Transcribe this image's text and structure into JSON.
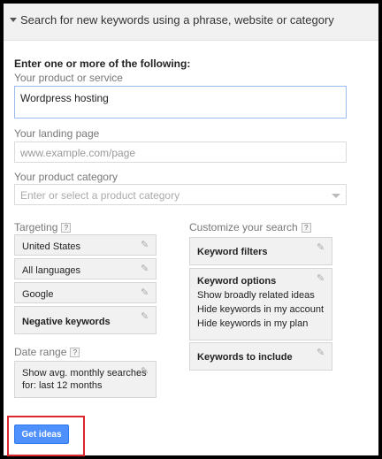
{
  "header": {
    "title": "Search for new keywords using a phrase, website or category"
  },
  "form": {
    "intro": "Enter one or more of the following:",
    "product_label": "Your product or service",
    "product_value": "Wordpress hosting",
    "landing_label": "Your landing page",
    "landing_placeholder": "www.example.com/page",
    "category_label": "Your product category",
    "category_placeholder": "Enter or select a product category"
  },
  "targeting": {
    "label": "Targeting",
    "help": "?",
    "items": [
      "United States",
      "All languages",
      "Google"
    ],
    "negative": "Negative keywords"
  },
  "date_range": {
    "label": "Date range",
    "help": "?",
    "line1": "Show avg. monthly searches",
    "line2": "for: last 12 months"
  },
  "customize": {
    "label": "Customize your search",
    "help": "?",
    "keyword_filters": "Keyword filters",
    "keyword_options": "Keyword options",
    "options": [
      "Show broadly related ideas",
      "Hide keywords in my account",
      "Hide keywords in my plan"
    ],
    "keywords_to_include": "Keywords to include"
  },
  "actions": {
    "get_ideas": "Get ideas"
  },
  "colors": {
    "primary_button": "#4d90fe",
    "highlight_border": "#e0262d"
  }
}
